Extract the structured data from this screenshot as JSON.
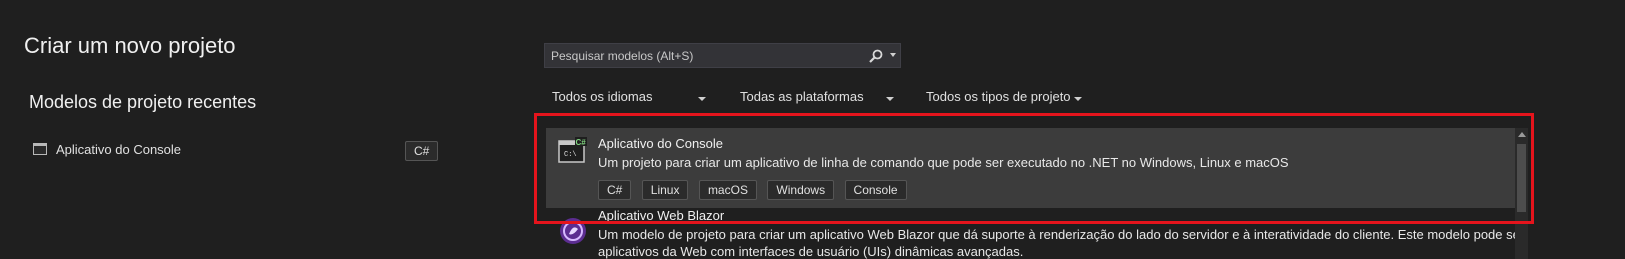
{
  "page": {
    "title": "Criar um novo projeto"
  },
  "recent": {
    "heading": "Modelos de projeto recentes",
    "items": [
      {
        "label": "Aplicativo do Console",
        "language": "C#"
      }
    ]
  },
  "search": {
    "placeholder": "Pesquisar modelos (Alt+S)"
  },
  "filters": {
    "language": "Todos os idiomas",
    "platform": "Todas as plataformas",
    "project_type": "Todos os tipos de projeto"
  },
  "templates": [
    {
      "title": "Aplicativo do Console",
      "description": "Um projeto para criar um aplicativo de linha de comando que pode ser executado no .NET no Windows, Linux e macOS",
      "tags": [
        "C#",
        "Linux",
        "macOS",
        "Windows",
        "Console"
      ],
      "icon": "console-app-icon"
    },
    {
      "title": "Aplicativo Web Blazor",
      "description": "Um modelo de projeto para criar um aplicativo Web Blazor que dá suporte à renderização do lado do servidor e à interatividade do cliente. Este modelo pode ser usado para",
      "description2": "aplicativos da Web com interfaces de usuário (UIs) dinâmicas avançadas.",
      "icon": "blazor-icon"
    }
  ],
  "colors": {
    "highlight": "#e5141c",
    "selected_bg": "#3c3c3c",
    "background": "#1f1f1f"
  }
}
